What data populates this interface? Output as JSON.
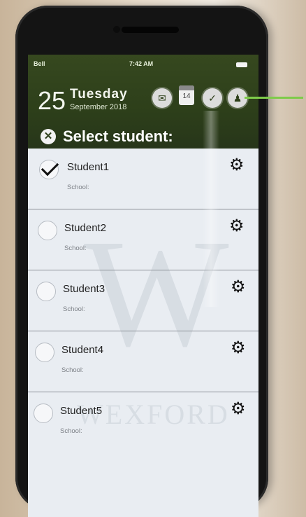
{
  "status_bar": {
    "carrier": "Bell",
    "time": "7:42 AM"
  },
  "header": {
    "day_number": "25",
    "weekday": "Tuesday",
    "month_year": "September 2018",
    "calendar_icon_number": "14",
    "icons": [
      "chat-bubble-icon",
      "calendar-icon",
      "checkmark-icon",
      "profile-icon"
    ]
  },
  "title": "Select student:",
  "students": [
    {
      "name": "Student1",
      "school_label": "School:",
      "selected": true
    },
    {
      "name": "Student2",
      "school_label": "School:",
      "selected": false
    },
    {
      "name": "Student3",
      "school_label": "School:",
      "selected": false
    },
    {
      "name": "Student4",
      "school_label": "School:",
      "selected": false
    },
    {
      "name": "Student5",
      "school_label": "School:",
      "selected": false
    }
  ],
  "watermark": {
    "letter": "W",
    "text": "WEXFORD"
  },
  "colors": {
    "header_green": "#2d3f1a",
    "annotation_green": "#7ecb4a"
  }
}
